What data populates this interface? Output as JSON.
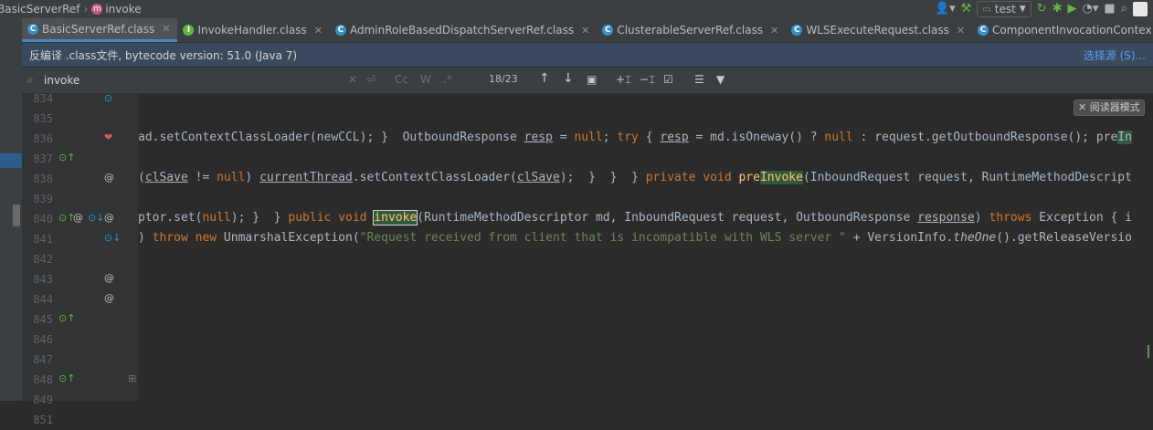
{
  "breadcrumb": {
    "file": "BasicServerRef",
    "sep": "›",
    "method_badge": "m",
    "method": "invoke"
  },
  "toolbar": {
    "run_config": "test"
  },
  "tabs": [
    {
      "label": "BasicServerRef.class",
      "icon": "C",
      "active": true
    },
    {
      "label": "InvokeHandler.class",
      "icon": "I",
      "active": false
    },
    {
      "label": "AdminRoleBasedDispatchServerRef.class",
      "icon": "C",
      "active": false
    },
    {
      "label": "ClusterableServerRef.class",
      "icon": "C",
      "active": false
    },
    {
      "label": "WLSExecuteRequest.class",
      "icon": "C",
      "active": false
    },
    {
      "label": "ComponentInvocationContex",
      "icon": "C",
      "active": false
    }
  ],
  "banner": {
    "text": "反编译 .class文件, bytecode version: 51.0 (Java 7)",
    "link": "选择源 (S)..."
  },
  "search": {
    "query": "invoke",
    "match_case": "Cc",
    "words": "W",
    "regex": ".*",
    "count": "18/23"
  },
  "reader_mode": "阅读器模式",
  "line_numbers": [
    "834",
    "835",
    "836",
    "837",
    "838",
    "839",
    "840",
    "841",
    "842",
    "843",
    "844",
    "845",
    "846",
    "847",
    "848",
    "849",
    "851"
  ],
  "colors": {
    "keyword": "#cc7832",
    "method": "#ffc66d",
    "string": "#6a8759",
    "text": "#a9b7c6",
    "match": "#32593d"
  }
}
